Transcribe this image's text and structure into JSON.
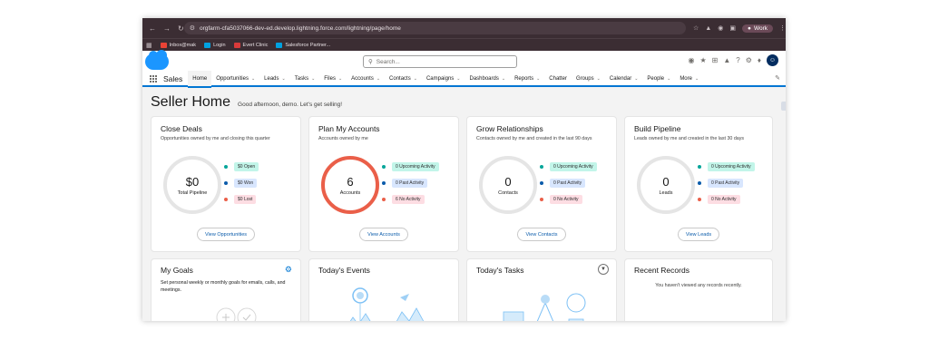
{
  "browser": {
    "url": "orgfarm-cfa5037066-dev-ed.develop.lightning.force.com/lightning/page/home",
    "profile": "Work",
    "bookmarks": [
      {
        "label": "Inbox@mak",
        "color": "#ea4335"
      },
      {
        "label": "Login",
        "color": "#00a1e0"
      },
      {
        "label": "Evert Clinic",
        "color": "#d93a3a"
      },
      {
        "label": "Salesforce Partner...",
        "color": "#00a1e0"
      }
    ]
  },
  "header": {
    "search_placeholder": "Search..."
  },
  "nav": {
    "app_name": "Sales",
    "items": [
      {
        "label": "Home",
        "active": true,
        "chevron": false
      },
      {
        "label": "Opportunities",
        "chevron": true
      },
      {
        "label": "Leads",
        "chevron": true
      },
      {
        "label": "Tasks",
        "chevron": true
      },
      {
        "label": "Files",
        "chevron": true
      },
      {
        "label": "Accounts",
        "chevron": true
      },
      {
        "label": "Contacts",
        "chevron": true
      },
      {
        "label": "Campaigns",
        "chevron": true
      },
      {
        "label": "Dashboards",
        "chevron": true
      },
      {
        "label": "Reports",
        "chevron": true
      },
      {
        "label": "Chatter",
        "chevron": false
      },
      {
        "label": "Groups",
        "chevron": true
      },
      {
        "label": "Calendar",
        "chevron": true
      },
      {
        "label": "People",
        "chevron": true
      },
      {
        "label": "More",
        "chevron": true
      }
    ]
  },
  "page": {
    "title": "Seller Home",
    "greeting": "Good afternoon, demo. Let's get selling!"
  },
  "colors": {
    "accent": "#0176d3",
    "teal": "#06a59a",
    "blue": "#0b5cab",
    "red": "#ea5f49"
  },
  "cards": [
    {
      "title": "Close Deals",
      "subtitle": "Opportunities owned by me and closing this quarter",
      "ring_value": "$0",
      "ring_label": "Total Pipeline",
      "ring_highlight": false,
      "stats": [
        {
          "label": "$0 Open",
          "dot": "#06a59a",
          "bg": "#c2f5e9"
        },
        {
          "label": "$0 Won",
          "dot": "#0b5cab",
          "bg": "#d8e6fe"
        },
        {
          "label": "$0 Lost",
          "dot": "#ea5f49",
          "bg": "#fddde3"
        }
      ],
      "button": "View Opportunities"
    },
    {
      "title": "Plan My Accounts",
      "subtitle": "Accounts owned by me",
      "ring_value": "6",
      "ring_label": "Accounts",
      "ring_highlight": true,
      "stats": [
        {
          "label": "0 Upcoming Activity",
          "dot": "#06a59a",
          "bg": "#c2f5e9"
        },
        {
          "label": "0 Past Activity",
          "dot": "#0b5cab",
          "bg": "#d8e6fe"
        },
        {
          "label": "6 No Activity",
          "dot": "#ea5f49",
          "bg": "#fddde3"
        }
      ],
      "button": "View Accounts"
    },
    {
      "title": "Grow Relationships",
      "subtitle": "Contacts owned by me and created in the last 90 days",
      "ring_value": "0",
      "ring_label": "Contacts",
      "ring_highlight": false,
      "stats": [
        {
          "label": "0 Upcoming Activity",
          "dot": "#06a59a",
          "bg": "#c2f5e9"
        },
        {
          "label": "0 Past Activity",
          "dot": "#0b5cab",
          "bg": "#d8e6fe"
        },
        {
          "label": "0 No Activity",
          "dot": "#ea5f49",
          "bg": "#fddde3"
        }
      ],
      "button": "View Contacts"
    },
    {
      "title": "Build Pipeline",
      "subtitle": "Leads owned by me and created in the last 30 days",
      "ring_value": "0",
      "ring_label": "Leads",
      "ring_highlight": false,
      "stats": [
        {
          "label": "0 Upcoming Activity",
          "dot": "#06a59a",
          "bg": "#c2f5e9"
        },
        {
          "label": "0 Past Activity",
          "dot": "#0b5cab",
          "bg": "#d8e6fe"
        },
        {
          "label": "0 No Activity",
          "dot": "#ea5f49",
          "bg": "#fddde3"
        }
      ],
      "button": "View Leads"
    }
  ],
  "bottom": {
    "goals_title": "My Goals",
    "goals_text": "Set personal weekly or monthly goals for emails, calls, and meetings.",
    "events_title": "Today's Events",
    "tasks_title": "Today's Tasks",
    "recent_title": "Recent Records",
    "recent_empty": "You haven't viewed any records recently."
  }
}
